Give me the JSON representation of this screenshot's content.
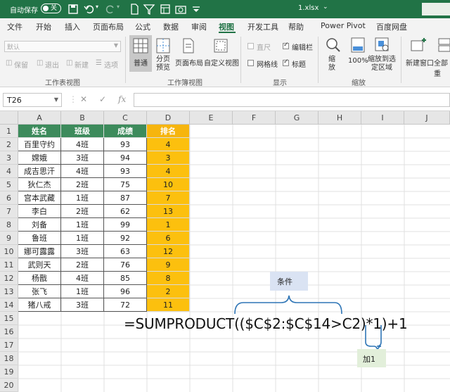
{
  "titlebar": {
    "autosave_label": "自动保存",
    "toggle_label": "关",
    "filename": "1.xlsx"
  },
  "menu": {
    "tabs": [
      "文件",
      "开始",
      "插入",
      "页面布局",
      "公式",
      "数据",
      "审阅",
      "视图",
      "开发工具",
      "帮助",
      "Power Pivot",
      "百度网盘"
    ],
    "active": "视图"
  },
  "ribbon": {
    "sheet_view": {
      "dropdown_value": "默认",
      "buttons": [
        "保留",
        "退出",
        "新建",
        "选项"
      ],
      "group_label": "工作表视图"
    },
    "workbook_view": {
      "buttons": [
        "普通",
        "分页预览",
        "页面布局",
        "自定义视图"
      ],
      "group_label": "工作簿视图"
    },
    "show": {
      "ruler": "直尺",
      "formula_bar": "编辑栏",
      "gridlines": "网格线",
      "headings": "标题",
      "group_label": "显示"
    },
    "zoom": {
      "buttons": [
        "缩放",
        "100%",
        "缩放到选定区域"
      ],
      "group_label": "缩放"
    },
    "window": {
      "buttons": [
        "新建窗口",
        "全部重"
      ]
    }
  },
  "formula_bar": {
    "name_box": "T26",
    "fx": "fx"
  },
  "columns": [
    "A",
    "B",
    "C",
    "D",
    "E",
    "F",
    "G",
    "H",
    "I",
    "J"
  ],
  "rows": [
    "1",
    "2",
    "3",
    "4",
    "5",
    "6",
    "7",
    "8",
    "9",
    "10",
    "11",
    "12",
    "13",
    "14",
    "15",
    "16",
    "17",
    "18",
    "19",
    "20"
  ],
  "table": {
    "headers": [
      "姓名",
      "班级",
      "成绩",
      "排名"
    ],
    "rows": [
      [
        "百里守约",
        "4班",
        "93",
        "4"
      ],
      [
        "嫦娥",
        "3班",
        "94",
        "3"
      ],
      [
        "成吉思汗",
        "4班",
        "93",
        "4"
      ],
      [
        "狄仁杰",
        "2班",
        "75",
        "10"
      ],
      [
        "宫本武藏",
        "1班",
        "87",
        "7"
      ],
      [
        "李白",
        "2班",
        "62",
        "13"
      ],
      [
        "刘备",
        "1班",
        "99",
        "1"
      ],
      [
        "鲁班",
        "1班",
        "92",
        "6"
      ],
      [
        "娜可露露",
        "3班",
        "63",
        "12"
      ],
      [
        "武则天",
        "2班",
        "76",
        "9"
      ],
      [
        "杨戬",
        "4班",
        "85",
        "8"
      ],
      [
        "张飞",
        "1班",
        "96",
        "2"
      ],
      [
        "猪八戒",
        "3班",
        "72",
        "11"
      ]
    ]
  },
  "annotations": {
    "formula": "=SUMPRODUCT(($C$2:$C$14>C2)*1)+1",
    "condition_label": "条件",
    "add_one_label": "加1"
  },
  "colors": {
    "excel_green": "#217346",
    "header_green": "#3d8b5c",
    "rank_gold": "#fcc00e",
    "condition_blue": "#dae3f3",
    "add_green": "#e2efda"
  }
}
